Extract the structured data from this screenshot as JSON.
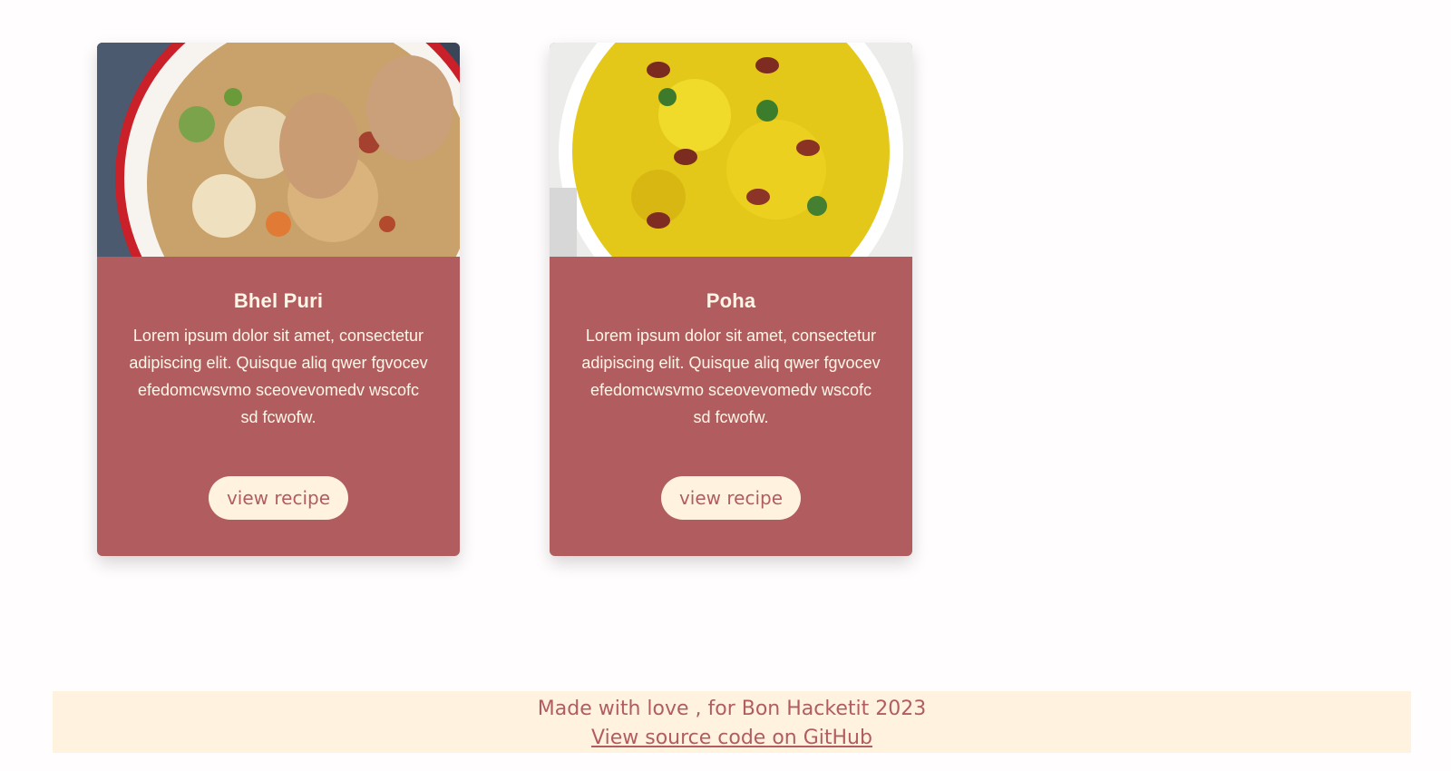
{
  "cards": [
    {
      "title": "Bhel Puri",
      "description": "Lorem ipsum dolor sit amet, consectetur adipiscing elit. Quisque aliq qwer fgvocev efedomcwsvmo sceovevomedv wscofc sd fcwofw.",
      "button_label": "view recipe"
    },
    {
      "title": "Poha",
      "description": "Lorem ipsum dolor sit amet, consectetur adipiscing elit. Quisque aliq qwer fgvocev efedomcwsvmo sceovevomedv wscofc sd fcwofw.",
      "button_label": "view recipe"
    }
  ],
  "footer": {
    "credit": "Made with love , for Bon Hacketit 2023",
    "link_label": "View source code on GitHub"
  },
  "colors": {
    "card_bg": "#b15d5f",
    "button_bg": "#fff3e0",
    "footer_bg": "#fff3e0",
    "text_light": "#fff6e7"
  }
}
